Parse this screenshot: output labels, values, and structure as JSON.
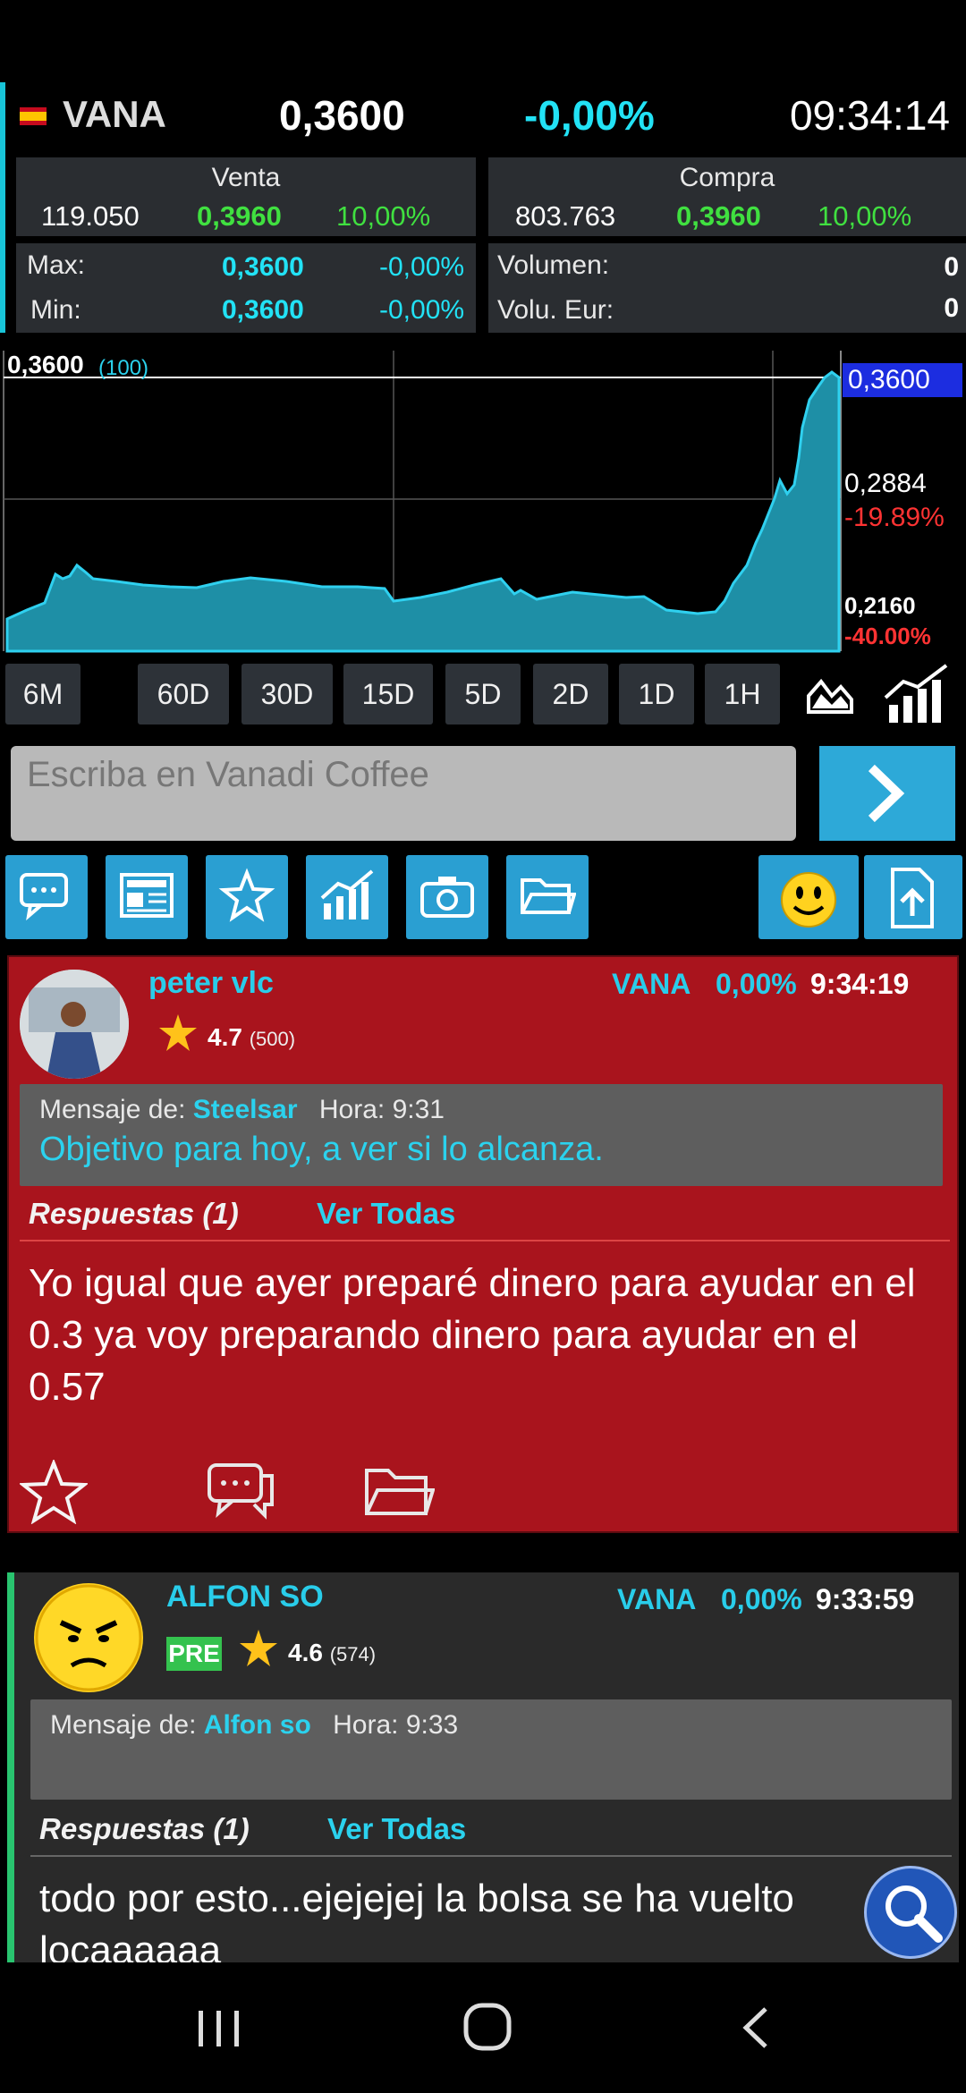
{
  "ticker": {
    "symbol": "VANA",
    "price": "0,3600",
    "change_pct": "-0,00%",
    "time": "09:34:14"
  },
  "venta": {
    "title": "Venta",
    "qty": "119.050",
    "price": "0,3960",
    "pct": "10,00%"
  },
  "compra": {
    "title": "Compra",
    "qty": "803.763",
    "price": "0,3960",
    "pct": "10,00%"
  },
  "stats": {
    "max_label": "Max:",
    "max_value": "0,3600",
    "max_pct": "-0,00%",
    "min_label": "Min:",
    "min_value": "0,3600",
    "min_pct": "-0,00%",
    "volumen_label": "Volumen:",
    "volumen_value": "0",
    "volu_eur_label": "Volu. Eur:",
    "volu_eur_value": "0"
  },
  "chart": {
    "top_left_label": "0,3600",
    "top_left_sub": "(100)",
    "current_price_badge": "0,3600",
    "level_mid": "0,2884",
    "level_mid_pct": "-19.89%",
    "level_low": "0,2160",
    "level_low_pct": "-40.00%",
    "top_hidden_label": "0,3600"
  },
  "periods": [
    "6M",
    "60D",
    "30D",
    "15D",
    "5D",
    "2D",
    "1D",
    "1H"
  ],
  "input": {
    "placeholder": "Escriba en Vanadi Coffee"
  },
  "toolbar": {
    "icons": [
      "chat-icon",
      "news-icon",
      "star-icon",
      "chart-icon",
      "camera-icon",
      "folder-icon",
      "smiley-icon",
      "upload-icon"
    ]
  },
  "posts": [
    {
      "author": "peter vlc",
      "symbol": "VANA",
      "pct": "0,00%",
      "time": "9:34:19",
      "rating": "4.7",
      "rating_count": "(500)",
      "quote_prefix": "Mensaje de:",
      "quote_author": "Steelsar",
      "quote_time_label": "Hora: 9:31",
      "quote_text": "Objetivo para hoy, a ver si lo alcanza.",
      "replies_label": "Respuestas (1)",
      "view_all": "Ver Todas",
      "body": "Yo igual que ayer preparé dinero para ayudar en el 0.3 ya voy preparando dinero para ayudar en el 0.57"
    },
    {
      "author": "ALFON SO",
      "badge": "PRE",
      "symbol": "VANA",
      "pct": "0,00%",
      "time": "9:33:59",
      "rating": "4.6",
      "rating_count": "(574)",
      "quote_prefix": "Mensaje de:",
      "quote_author": "Alfon so",
      "quote_time_label": "Hora: 9:33",
      "replies_label": "Respuestas (1)",
      "view_all": "Ver Todas",
      "body": "todo por esto...ejejejej la bolsa se ha vuelto locaaaaaa"
    }
  ],
  "colors": {
    "accent_cyan": "#22e2f5",
    "green": "#40e040",
    "post_red": "#a9141d",
    "button_blue": "#2a9fd2"
  }
}
